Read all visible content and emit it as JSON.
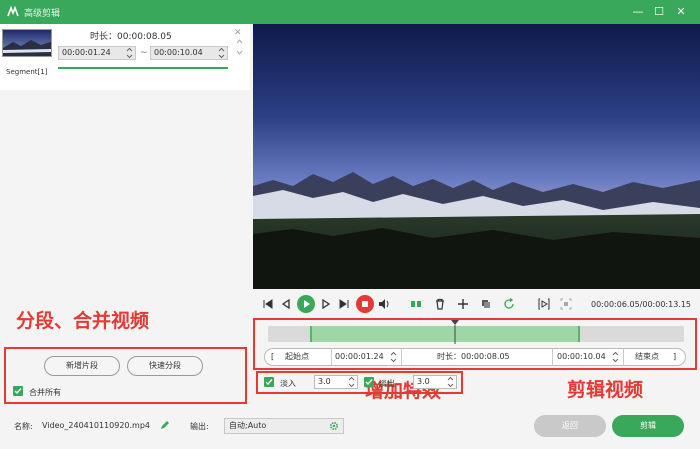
{
  "window": {
    "title": "高级剪辑"
  },
  "segment": {
    "duration_label": "时长：00:00:08.05",
    "start": "00:00:01.24",
    "tilde": "~",
    "end": "00:00:10.04",
    "label": "Segment[1]",
    "progress": 1.0
  },
  "annotations": {
    "segment_merge": "分段、合并视频",
    "edit_video": "剪辑视频",
    "add_effects": "增加特效"
  },
  "segment_panel": {
    "new_segment": "新增片段",
    "quick_segment": "快速分段",
    "merge_all": "合并所有",
    "merge_all_checked": true
  },
  "player": {
    "timecode": "00:00:06.05/00:00:13.15"
  },
  "trim": {
    "start_point_label": "起始点",
    "start_value": "00:00:01.24",
    "duration_label": "时长：00:00:08.05",
    "end_value": "00:00:10.04",
    "end_point_label": "结束点",
    "selection_start_fraction": 0.1,
    "selection_end_fraction": 0.75,
    "playhead_fraction": 0.45
  },
  "effects": {
    "fade_in_label": "淡入",
    "fade_in_value": "3.0",
    "fade_in_checked": true,
    "fade_out_label": "淡出",
    "fade_out_value": "3.0",
    "fade_out_checked": true
  },
  "footer": {
    "name_label": "名称:",
    "file_name": "Video_240410110920.mp4",
    "output_label": "输出:",
    "output_value": "自动;Auto",
    "back_button": "返回",
    "edit_button": "剪辑"
  },
  "colors": {
    "accent": "#3aa85a",
    "annotation": "#e53935"
  }
}
